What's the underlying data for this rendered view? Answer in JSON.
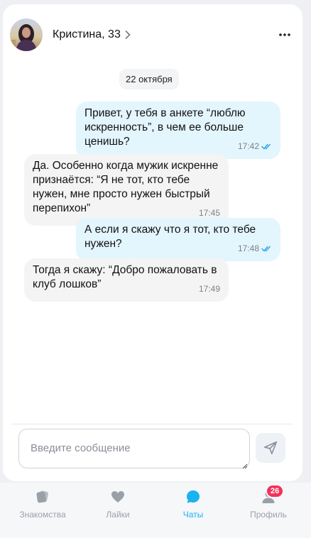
{
  "header": {
    "name": "Кристина, 33",
    "avatar": "avatar-photo",
    "more_icon": "more-dots-icon",
    "chevron_icon": "chevron-right-icon"
  },
  "chat": {
    "date": "22 октября",
    "messages": [
      {
        "direction": "out",
        "text": "Привет, у тебя в анкете “люблю искренность”, в чем ее больше ценишь?",
        "time": "17:42",
        "read": true
      },
      {
        "direction": "in",
        "text": "Да. Особенно когда мужик искренне признаётся: “Я не тот, кто тебе нужен, мне просто нужен быстрый перепихон”",
        "time": "17:45"
      },
      {
        "direction": "out",
        "text": "А если я скажу что я тот, кто тебе нужен?",
        "time": "17:48",
        "read": true
      },
      {
        "direction": "in",
        "text": "Тогда я скажу: “Добро пожаловать в клуб лошков”",
        "time": "17:49"
      }
    ]
  },
  "composer": {
    "placeholder": "Введите сообщение",
    "send_icon": "send-icon"
  },
  "tabbar": {
    "tabs": [
      {
        "label": "Знакомства",
        "icon": "cards-icon",
        "active": false
      },
      {
        "label": "Лайки",
        "icon": "heart-icon",
        "active": false
      },
      {
        "label": "Чаты",
        "icon": "chat-bubble-icon",
        "active": true
      },
      {
        "label": "Профиль",
        "icon": "person-icon",
        "active": false
      }
    ],
    "profile_badge": "26"
  },
  "colors": {
    "accent": "#1ab2f0",
    "outgoing_bubble": "#e3f5fd",
    "incoming_bubble": "#f4f4f5",
    "badge": "#f2335b"
  }
}
